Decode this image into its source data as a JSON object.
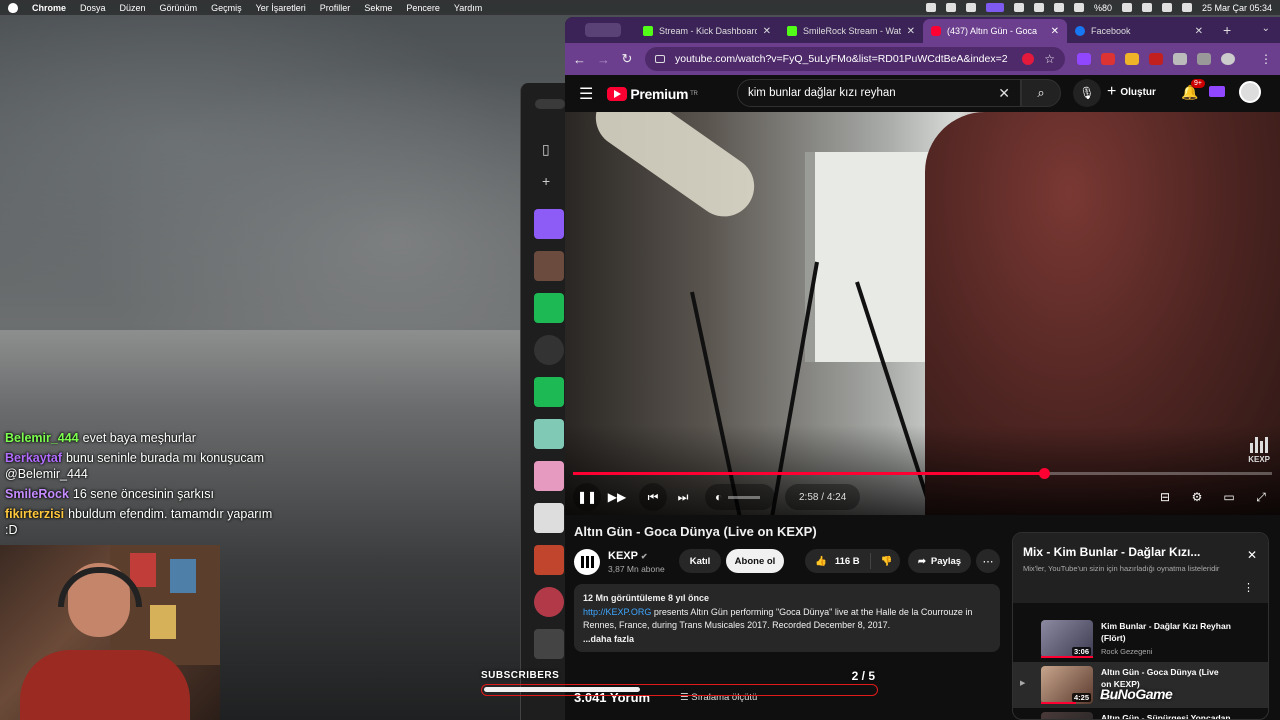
{
  "menubar": {
    "app": "Chrome",
    "items": [
      "Dosya",
      "Düzen",
      "Görünüm",
      "Geçmiş",
      "Yer İşaretleri",
      "Profiller",
      "Sekme",
      "Pencere",
      "Yardım"
    ],
    "battery": "%80",
    "datetime": "25 Mar Çar  05:34"
  },
  "chat": [
    {
      "user": "Belemir_444",
      "color": "#7dff4f",
      "text": "evet baya meşhurlar"
    },
    {
      "user": "Berkaytaf",
      "color": "#b26cff",
      "text": "bunu seninle burada mı konuşucam @Belemir_444"
    },
    {
      "user": "SmileRock",
      "color": "#c58cff",
      "text": "16 sene öncesinin şarkısı"
    },
    {
      "user": "fikirterzisi",
      "color": "#ffc83d",
      "text": "hbuldum efendim. tamamdır yaparım :D"
    }
  ],
  "tabs": [
    {
      "title": "Stream - Kick Dashboard",
      "icon": "kick-icon",
      "active": false
    },
    {
      "title": "SmileRock Stream - Watch",
      "icon": "kick-icon",
      "active": false
    },
    {
      "title": "(437) Altın Gün - Goca",
      "icon": "youtube-icon",
      "active": true
    },
    {
      "title": "Facebook",
      "icon": "facebook-icon",
      "active": false
    }
  ],
  "address": {
    "url": "youtube.com/watch?v=FyQ_5uLyFMo&list=RD01PuWCdtBeA&index=2"
  },
  "youtube": {
    "brand": "Premium",
    "region": "TR",
    "search_value": "kim bunlar dağlar kızı reyhan",
    "create_label": "Oluştur",
    "notif_count": "9+"
  },
  "player": {
    "current_time": "2:58",
    "duration": "4:24",
    "progress": 0.6742,
    "volume": 0.0,
    "watermark": "KEXP"
  },
  "video": {
    "title": "Altın Gün - Goca Dünya (Live on KEXP)",
    "channel": "KEXP",
    "subscribers": "3,87 Mn abone",
    "join_label": "Katıl",
    "subscribe_label": "Abone ol",
    "likes": "116 B",
    "share_label": "Paylaş",
    "desc_meta": "12 Mn görüntüleme  8 yıl önce",
    "desc_link": "http://KEXP.ORG",
    "desc_text": " presents Altın Gün performing \"Goca Dünya\" live at the Halle de la Courrouze in Rennes, France, during Trans Musicales 2017. Recorded December 8, 2017.",
    "desc_more": "...daha fazla",
    "comments_count": "3.041 Yorum",
    "sort_label": "Sıralama ölçütü"
  },
  "mix": {
    "title": "Mix - Kim Bunlar - Dağlar Kızı...",
    "subtitle": "Mix'ler, YouTube'un sizin için hazırladığı oynatma listeleridir",
    "items": [
      {
        "title": "Kim Bunlar - Dağlar Kızı Reyhan (Flört)",
        "channel": "Rock Gezegeni",
        "duration": "3:06",
        "current": false
      },
      {
        "title": "Altın Gün - Goca Dünya (Live on KEXP)",
        "channel": "KEXP",
        "duration": "4:25",
        "current": true
      },
      {
        "title": "Altın Gün - Süpürgesi Yoncadan (Live on KEXP)",
        "channel": "",
        "duration": "",
        "current": false
      }
    ]
  },
  "overlay": {
    "label": "SUBSCRIBERS",
    "count": "2  / 5",
    "progress": 0.4,
    "logo": "BuNoGame"
  }
}
